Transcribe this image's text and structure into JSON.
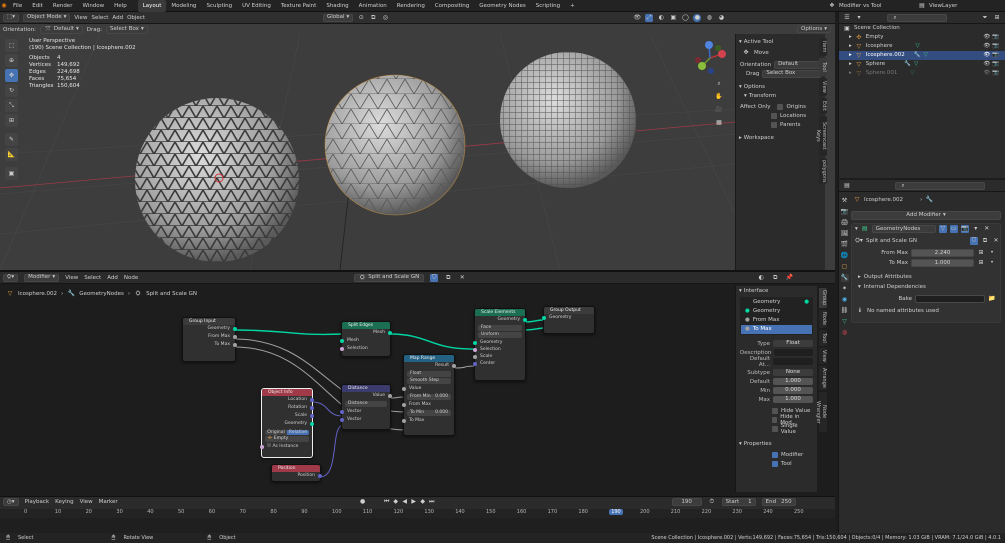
{
  "menus": [
    "File",
    "Edit",
    "Render",
    "Window",
    "Help"
  ],
  "workspaces": [
    "Layout",
    "Modeling",
    "Sculpting",
    "UV Editing",
    "Texture Paint",
    "Shading",
    "Animation",
    "Rendering",
    "Compositing",
    "Geometry Nodes",
    "Scripting",
    "+"
  ],
  "scene": "Modifier vs Tool",
  "viewlayer": "ViewLayer",
  "viewport": {
    "mode": "Object Mode",
    "view": "View",
    "select": "Select",
    "add": "Add",
    "object": "Object",
    "orientation_label": "Orientation:",
    "orientation": "Default",
    "drag_label": "Drag:",
    "drag": "Select Box",
    "transform": "Global",
    "options": "Options",
    "perspective": "User Perspective",
    "collection": "(190) Scene Collection | Icosphere.002",
    "stats": [
      {
        "k": "Objects",
        "v": "4"
      },
      {
        "k": "Vertices",
        "v": "149,692"
      },
      {
        "k": "Edges",
        "v": "224,698"
      },
      {
        "k": "Faces",
        "v": "75,654"
      },
      {
        "k": "Triangles",
        "v": "150,604"
      }
    ]
  },
  "npanel": {
    "active_tool": "Active Tool",
    "move": "Move",
    "orientation_label": "Orientation",
    "orientation": "Default",
    "drag_label": "Drag",
    "drag": "Select Box",
    "options": "Options",
    "transform": "Transform",
    "affect_only": "Affect Only",
    "origins": "Origins",
    "locations": "Locations",
    "parents": "Parents",
    "workspace": "Workspace",
    "tabs": [
      "Item",
      "Tool",
      "View",
      "Edit",
      "Screencast Keys",
      "polygons"
    ]
  },
  "outliner": {
    "root": "Scene Collection",
    "items": [
      {
        "name": "Empty"
      },
      {
        "name": "Icosphere"
      },
      {
        "name": "Icosphere.002"
      },
      {
        "name": "Sphere"
      },
      {
        "name": "Sphere.001"
      }
    ]
  },
  "properties": {
    "object": "Icosphere.002",
    "modifier_name": "GeometryNodes",
    "add_modifier": "Add Modifier",
    "group": "GeometryNodes",
    "node_group": "Split and Scale GN",
    "from_max_label": "From Max",
    "from_max": "2.240",
    "to_max_label": "To Max",
    "to_max": "1.000",
    "output_attrs": "Output Attributes",
    "internal_deps": "Internal Dependencies",
    "bake": "Bake",
    "no_named": "No named attributes used"
  },
  "node_editor": {
    "editor": "Modifier",
    "view": "View",
    "select": "Select",
    "add": "Add",
    "node": "Node",
    "tree": "Split and Scale GN",
    "crumbs": [
      "Icosphere.002",
      "GeometryNodes",
      "Split and Scale GN"
    ],
    "group_input": {
      "title": "Group Input",
      "sockets": [
        "Geometry",
        "From Max",
        "To Max"
      ]
    },
    "split_edges": {
      "title": "Split Edges",
      "out": "Mesh",
      "in": [
        "Mesh",
        "Selection"
      ]
    },
    "scale_elements": {
      "title": "Scale Elements",
      "out": "Geometry",
      "in": [
        "Geometry"
      ],
      "domain": "Face",
      "mode": "Uniform",
      "inputs": [
        "Geometry",
        "Selection",
        "Scale",
        "Center"
      ]
    },
    "group_output": {
      "title": "Group Output",
      "in": "Geometry"
    },
    "map_range": {
      "title": "Map Range",
      "out": "Result",
      "type": "Float",
      "interp": "Smooth Step",
      "value": "Value",
      "from_min": "From Min",
      "from_min_v": "0.000",
      "from_max": "From Max",
      "to_min": "To Min",
      "to_min_v": "0.000",
      "to_max": "To Max"
    },
    "distance": {
      "title": "Distance",
      "out": "Value",
      "mode": "Distance",
      "in": [
        "Vector",
        "Vector"
      ]
    },
    "object_info": {
      "title": "Object Info",
      "outs": [
        "Location",
        "Rotation",
        "Scale",
        "Geometry"
      ],
      "original": "Original",
      "relative": "Relative",
      "object": "Empty",
      "as_instance": "As Instance"
    },
    "position": {
      "title": "Position",
      "out": "Position"
    },
    "tabs": [
      "Group",
      "Node",
      "Tool",
      "View",
      "Arrange",
      "Node Wrangler"
    ]
  },
  "interface": {
    "title": "Interface",
    "sockets": [
      "Geometry",
      "Geometry",
      "From Max",
      "To Max"
    ],
    "type_label": "Type",
    "type": "Float",
    "desc_label": "Description",
    "default_attr_label": "Default At...",
    "subtype_label": "Subtype",
    "subtype": "None",
    "default_label": "Default",
    "default": "1.000",
    "min_label": "Min",
    "min": "0.000",
    "max_label": "Max",
    "max": "1.000",
    "hide_value": "Hide Value",
    "hide_in_mod": "Hide in Mod...",
    "single_value": "Single Value",
    "properties": "Properties",
    "modifier": "Modifier",
    "tool": "Tool"
  },
  "timeline": {
    "playback": "Playback",
    "keying": "Keying",
    "view": "View",
    "marker": "Marker",
    "current": "190",
    "start_label": "Start",
    "start": "1",
    "end_label": "End",
    "end": "250",
    "ticks": [
      "0",
      "10",
      "20",
      "30",
      "40",
      "50",
      "60",
      "70",
      "80",
      "90",
      "100",
      "110",
      "120",
      "130",
      "140",
      "150",
      "160",
      "170",
      "180",
      "190",
      "200",
      "210",
      "220",
      "230",
      "240",
      "250"
    ]
  },
  "status": {
    "select": "Select",
    "rotate": "Rotate View",
    "object": "Object",
    "info": "Scene Collection | Icosphere.002 | Verts:149,692 | Faces:75,654 | Tris:150,604 | Objects:0/4 | Memory: 1.03 GiB | VRAM: 7.1/24.0 GiB | 4.0.1"
  }
}
